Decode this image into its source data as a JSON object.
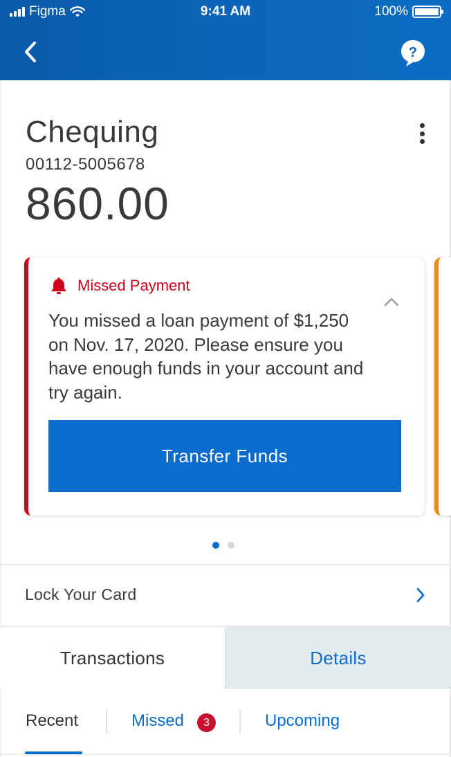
{
  "status_bar": {
    "carrier": "Figma",
    "time": "9:41 AM",
    "battery": "100%"
  },
  "nav": {
    "back_icon": "chevron-left-icon",
    "help_icon": "help-bubble-icon"
  },
  "account": {
    "name": "Chequing",
    "number": "00112-5005678",
    "balance": "860.00"
  },
  "alert": {
    "title": "Missed Payment",
    "body": "You missed a loan payment of $1,250 on Nov. 17, 2020. Please ensure you have enough funds in your account and try again.",
    "button_label": "Transfer Funds",
    "accent_color": "#d0021b",
    "next_card_accent": "#ee8a0f"
  },
  "carousel": {
    "page_count": 2,
    "active_index": 0
  },
  "lock_card": {
    "label": "Lock Your Card"
  },
  "tabs": [
    {
      "label": "Transactions",
      "active": true
    },
    {
      "label": "Details",
      "active": false
    }
  ],
  "subtabs": {
    "recent": "Recent",
    "missed": "Missed",
    "missed_count": "3",
    "upcoming": "Upcoming"
  },
  "colors": {
    "brand_blue": "#0a6ccf",
    "alert_red": "#d0021b"
  }
}
